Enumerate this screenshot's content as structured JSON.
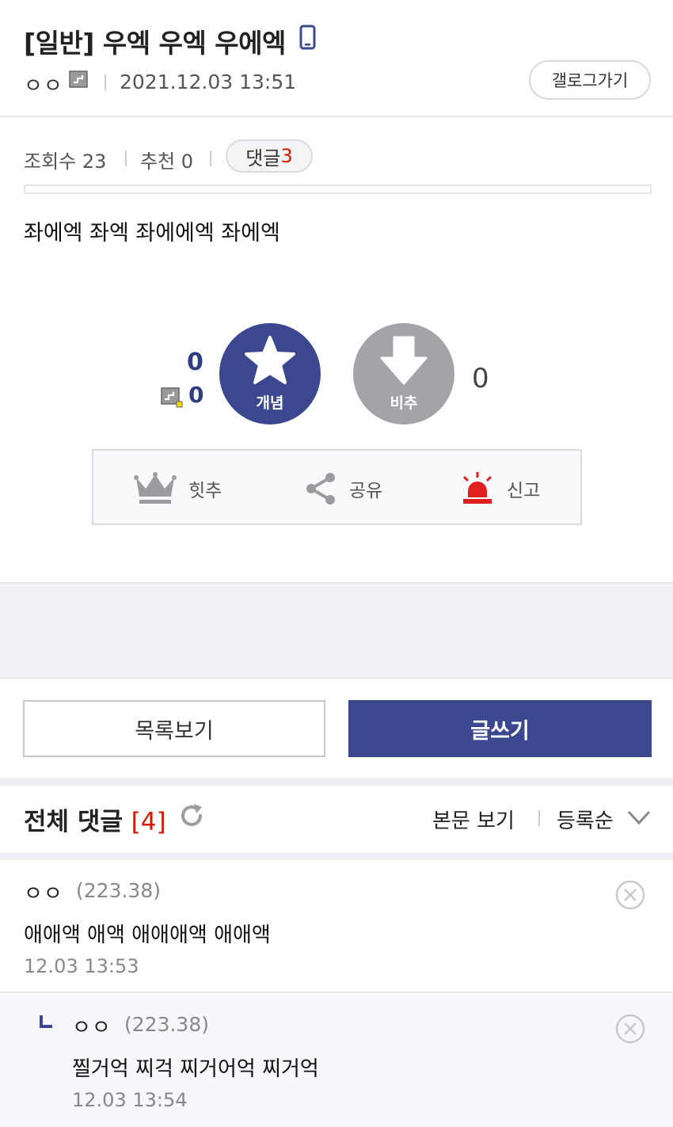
{
  "post": {
    "title": "[일반] 우엑 우엑 우에엑",
    "writer": "ㅇㅇ",
    "date": "2021.12.03 13:51",
    "gallery_button": "갤로그가기",
    "views_label": "조회수 23",
    "recommend_label": "추천 0",
    "comment_label": "댓글",
    "comment_count": "3",
    "body": "좌에엑 좌엑 좌에에엑 좌에엑"
  },
  "vote": {
    "up_count": "0",
    "fixed_up_count": "0",
    "up_label": "개념",
    "down_label": "비추",
    "down_count": "0"
  },
  "actions": {
    "hit": "힛추",
    "share": "공유",
    "report": "신고"
  },
  "buttons": {
    "list": "목록보기",
    "write": "글쓰기"
  },
  "comments_header": {
    "title": "전체 댓글",
    "count": "[4]",
    "view_body": "본문 보기",
    "sort": "등록순"
  },
  "comments": [
    {
      "name": "ㅇㅇ",
      "ip": "(223.38)",
      "text": "애애액 애액 애애애액 애애액",
      "time": "12.03 13:53"
    },
    {
      "name": "ㅇㅇ",
      "ip": "(223.38)",
      "text": "찔거억 찌걱 찌거어억 찌거억",
      "time": "12.03 13:54"
    }
  ],
  "colors": {
    "accent": "#3b4890",
    "count_red": "#d31900",
    "downvote_gray": "#a3a4a8",
    "report_red": "#e02020"
  },
  "icons": [
    "mobile-icon",
    "fixed-user-icon",
    "star-icon",
    "down-arrow-icon",
    "crown-icon",
    "share-icon",
    "siren-icon",
    "refresh-icon",
    "chevron-down-icon",
    "delete-icon",
    "reply-icon"
  ]
}
